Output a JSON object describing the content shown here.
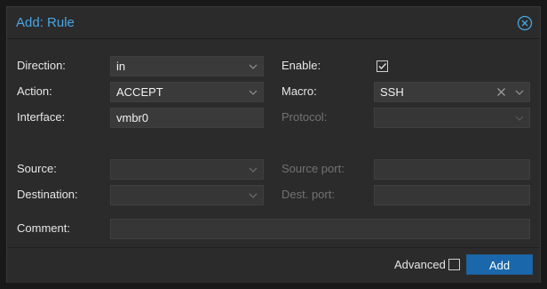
{
  "dialog": {
    "title": "Add: Rule"
  },
  "form": {
    "direction": {
      "label": "Direction:",
      "value": "in"
    },
    "action": {
      "label": "Action:",
      "value": "ACCEPT"
    },
    "interface": {
      "label": "Interface:",
      "value": "vmbr0"
    },
    "enable": {
      "label": "Enable:",
      "checked": true
    },
    "macro": {
      "label": "Macro:",
      "value": "SSH"
    },
    "protocol": {
      "label": "Protocol:",
      "value": ""
    },
    "source": {
      "label": "Source:",
      "value": ""
    },
    "destination": {
      "label": "Destination:",
      "value": ""
    },
    "source_port": {
      "label": "Source port:",
      "value": ""
    },
    "dest_port": {
      "label": "Dest. port:",
      "value": ""
    },
    "comment": {
      "label": "Comment:",
      "value": ""
    }
  },
  "footer": {
    "advanced_label": "Advanced",
    "advanced_checked": false,
    "add_label": "Add"
  },
  "colors": {
    "accent": "#4aa6e6",
    "primary_button": "#1a68ab"
  }
}
